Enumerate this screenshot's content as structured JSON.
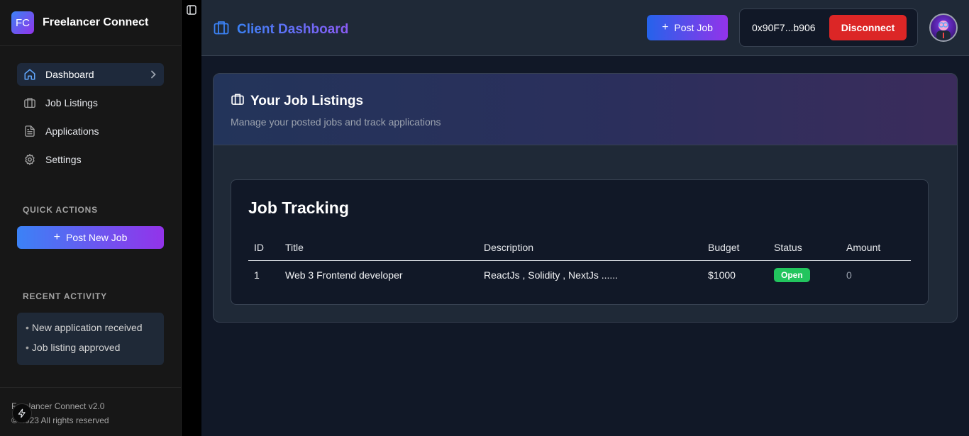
{
  "brand": {
    "logo_text": "FC",
    "name": "Freelancer Connect"
  },
  "nav": {
    "items": [
      {
        "label": "Dashboard",
        "icon": "home-icon",
        "active": true
      },
      {
        "label": "Job Listings",
        "icon": "briefcase-icon",
        "active": false
      },
      {
        "label": "Applications",
        "icon": "file-text-icon",
        "active": false
      },
      {
        "label": "Settings",
        "icon": "gear-icon",
        "active": false
      }
    ]
  },
  "quick_actions": {
    "label": "QUICK ACTIONS",
    "post_new_job": "Post New Job"
  },
  "recent_activity": {
    "label": "RECENT ACTIVITY",
    "items": [
      "New application received",
      "Job listing approved"
    ]
  },
  "footer": {
    "version": "Freelancer Connect v2.0",
    "copyright": "© 2023 All rights reserved"
  },
  "header": {
    "title": "Client Dashboard",
    "post_job": "Post Job",
    "wallet_address": "0x90F7...b906",
    "disconnect": "Disconnect"
  },
  "listings": {
    "title": "Your Job Listings",
    "subtitle": "Manage your posted jobs and track applications"
  },
  "tracking": {
    "title": "Job Tracking",
    "columns": [
      "ID",
      "Title",
      "Description",
      "Budget",
      "Status",
      "Amount"
    ],
    "rows": [
      {
        "id": "1",
        "title": "Web 3 Frontend developer",
        "description": "ReactJs , Solidity , NextJs ......",
        "budget": "$1000",
        "status": "Open",
        "amount": "0"
      }
    ]
  },
  "colors": {
    "accent_blue": "#3b82f6",
    "accent_purple": "#9333ea",
    "danger": "#dc2626",
    "success": "#22c55e"
  }
}
